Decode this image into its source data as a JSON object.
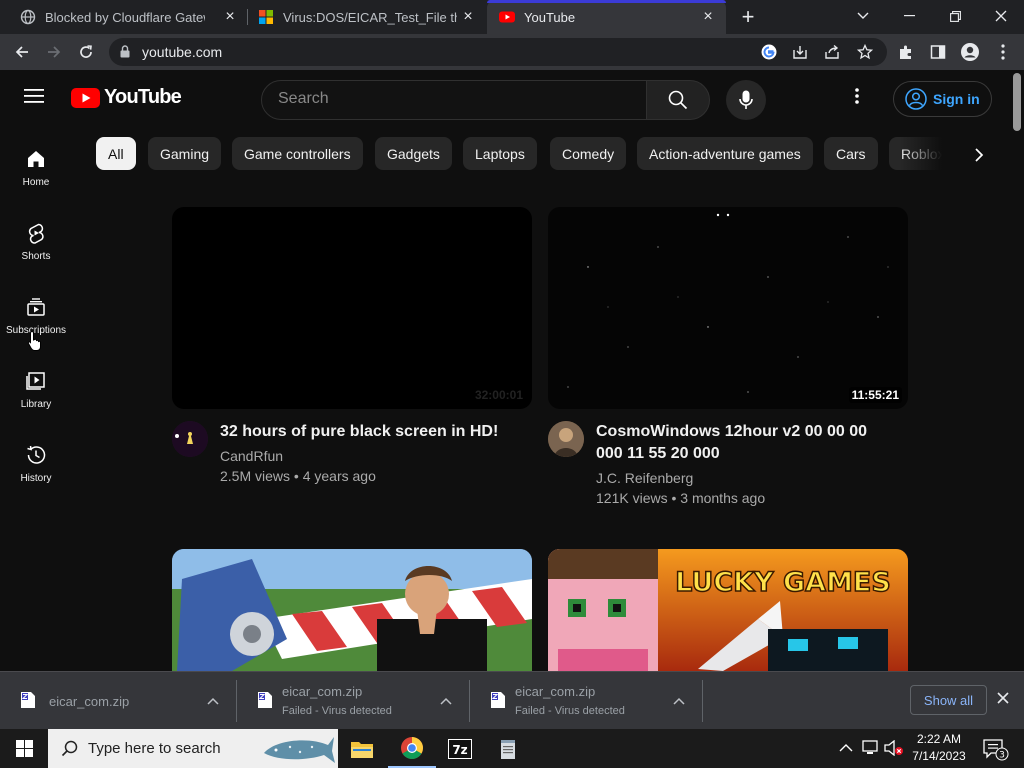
{
  "browser": {
    "tabs": [
      {
        "title": "Blocked by Cloudflare Gateway",
        "favicon": "globe-icon",
        "active": false
      },
      {
        "title": "Virus:DOS/EICAR_Test_File threat",
        "favicon": "microsoft-icon",
        "active": false
      },
      {
        "title": "YouTube",
        "favicon": "youtube-icon",
        "active": true
      }
    ],
    "address": "youtube.com"
  },
  "youtube": {
    "logo_text": "YouTube",
    "search_placeholder": "Search",
    "sign_in": "Sign in",
    "chips": [
      "All",
      "Gaming",
      "Game controllers",
      "Gadgets",
      "Laptops",
      "Comedy",
      "Action-adventure games",
      "Cars",
      "Roblox"
    ],
    "sidebar": [
      {
        "label": "Home",
        "icon": "home-icon"
      },
      {
        "label": "Shorts",
        "icon": "shorts-icon"
      },
      {
        "label": "Subscriptions",
        "icon": "subscriptions-icon"
      },
      {
        "label": "Library",
        "icon": "library-icon"
      },
      {
        "label": "History",
        "icon": "history-icon"
      }
    ],
    "videos": [
      {
        "title": "32 hours of pure black screen in HD!",
        "channel": "CandRfun",
        "meta": "2.5M views • 4 years ago",
        "duration": "32:00:01"
      },
      {
        "title_line1": "CosmoWindows 12hour v2 00 00 00",
        "title_line2": "000 11 55 20 000",
        "channel": "J.C. Reifenberg",
        "meta": "121K views • 3 months ago",
        "duration": "11:55:21"
      },
      {
        "title": "",
        "channel": "",
        "meta": "",
        "duration": ""
      },
      {
        "thumb_text": "LUCKY GAMES"
      }
    ]
  },
  "downloads": {
    "items": [
      {
        "name": "eicar_com.zip",
        "status": ""
      },
      {
        "name": "eicar_com.zip",
        "status": "Failed - Virus detected"
      },
      {
        "name": "eicar_com.zip",
        "status": "Failed - Virus detected"
      }
    ],
    "show_all": "Show all"
  },
  "taskbar": {
    "search_placeholder": "Type here to search",
    "time": "2:22 AM",
    "date": "7/14/2023",
    "notification_count": "3"
  },
  "colors": {
    "accent_link": "#3ea6ff",
    "youtube_red": "#ff0000",
    "tab_accent": "#3b3bd6"
  }
}
